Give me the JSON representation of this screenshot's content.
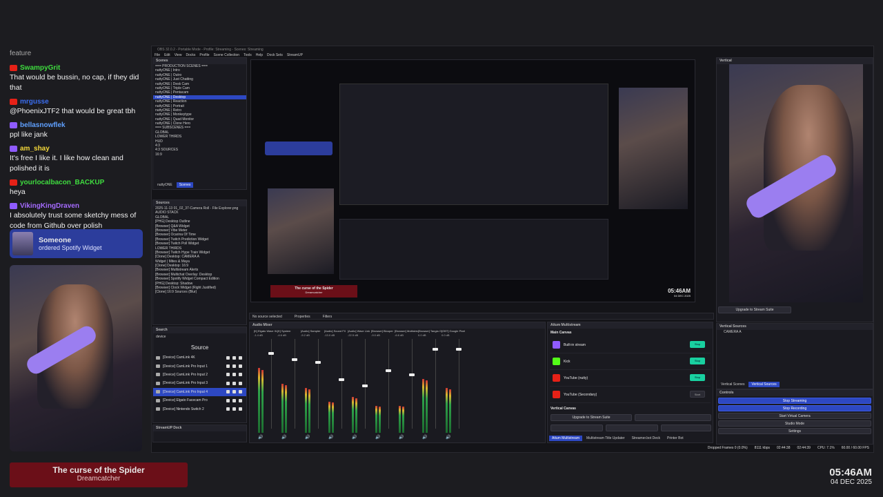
{
  "chat": {
    "header": "feature",
    "messages": [
      {
        "user": "SwampyGrit",
        "platform": "youtube",
        "color": "#3fdc3f",
        "text": "That would be bussin, no cap, if they did that"
      },
      {
        "user": "mrgusse",
        "platform": "youtube",
        "color": "#3a6df0",
        "text": "@PhoenixJTF2 that would be great tbh"
      },
      {
        "user": "bellasnowflek",
        "platform": "twitch",
        "color": "#5fa0ff",
        "text": "ppl like jank"
      },
      {
        "user": "am_shay",
        "platform": "twitch",
        "color": "#f5d93a",
        "text": "It's free I like it. I like how clean and polished it is"
      },
      {
        "user": "yourlocalbacon_BACKUP",
        "platform": "youtube",
        "color": "#3fdc3f",
        "text": "heya"
      },
      {
        "user": "VikingKingDraven",
        "platform": "twitch",
        "color": "#a56bff",
        "text": "I absolutely trust some sketchy mess of code from Github over polish"
      }
    ]
  },
  "alert": {
    "name": "Someone",
    "action": "ordered Spotify Widget"
  },
  "now_playing": {
    "title": "The curse of the Spider",
    "artist": "Dreamcatcher"
  },
  "clock": {
    "time": "05:46AM",
    "date": "04 DEC 2025"
  },
  "obs": {
    "title": "OBS 32.0.2 - Portable Mode - Profile: Streaming - Scenes: Streaming",
    "menu": [
      "File",
      "Edit",
      "View",
      "Docks",
      "Profile",
      "Scene Collection",
      "Tools",
      "Help",
      "Dock Sets",
      "StreamUP"
    ],
    "scenes_header": "Scenes",
    "scenes": [
      "=== PRODUCTION SCENES ===",
      "nuttyONE | Intro",
      "nuttyONE | Outro",
      "nuttyONE | Just Chatting",
      "nuttyONE | Desk Cam",
      "nuttyONE | Triple Cam",
      "nuttyONE | Pentacam",
      "nuttyONE | Desktop",
      "nuttyONE | Reaction",
      "nuttyONE | Portrait",
      "nuttyONE | Retro",
      "nuttyONE | Monkeytype",
      "nuttyONE | Quad Monitor",
      "nuttyONE | Clone Hero",
      "=== SUBSCENES ===",
      "GLOBAL",
      "LOWER THIRDS",
      "HUD",
      "4:3",
      "4:3 SOURCES",
      "16:9"
    ],
    "selected_scene": 7,
    "scene_tabs": [
      "nuttyONE",
      "Scenes"
    ],
    "sources_header": "Sources",
    "sources": [
      "2025-11-13 01_02_37-Camera Roll - File Explorer.png",
      "AUDIO STACK",
      "GLOBAL",
      "[PHG] Desktop Outline",
      "[Browser] Q&A Widget",
      "[Browser] Vibe Meter",
      "[Browser] Ocarina Of Time",
      "[Browser] Twitch Prediction Widget",
      "[Browser] Twitch Poll Widget",
      "LOWER THIRDS",
      "[Browser] Twitch Hype Train Widget",
      "[Clone] Desktop: CAMERA A",
      "Widget | Mites & Maya",
      "[Clone] Desktop: 16:9",
      "[Browser] Multistream Alerts",
      "[Browser] Multichat Overlay: Desktop",
      "[Browser] Spotify Widget Compact Edition",
      "[PHG] Desktop: Shadow",
      "[Browser] Clock Widget (Right Justified)",
      "[Clone] 16:9 Sources (Blur)"
    ],
    "search_header": "Search",
    "search_value": "device",
    "source_dock_title": "Source",
    "devices": [
      "[Device] CamLink 4K",
      "[Device] CamLink Pro Input 1",
      "[Device] CamLink Pro Input 2",
      "[Device] CamLink Pro Input 3",
      "[Device] CamLink Pro Input 4",
      "[Device] Elgato Facecam Pro",
      "[Device] Nintendo Switch 2"
    ],
    "selected_device": 4,
    "streamup_dock": "StreamUP Dock",
    "no_source": "No source selected",
    "properties": "Properties",
    "filters": "Filters",
    "mixer_header": "Audio Mixer",
    "mixer_channels": [
      {
        "name": "[K] Elgato Wave XLR",
        "db": "-1.4 dB",
        "level": 0.72,
        "fader": 0.85
      },
      {
        "name": "[K] System",
        "db": "-4.6 dB",
        "level": 0.55,
        "fader": 0.78
      },
      {
        "name": "[Audio] Sampler",
        "db": "-5.2 dB",
        "level": 0.5,
        "fader": 0.75
      },
      {
        "name": "[Audio] Sound FX",
        "db": "-13.0 dB",
        "level": 0.35,
        "fader": 0.55
      },
      {
        "name": "[Audio] Wave Link",
        "db": "-22.5 dB",
        "level": 0.4,
        "fader": 0.48
      },
      {
        "name": "[Browser] Blooper",
        "db": "-9.0 dB",
        "level": 0.3,
        "fader": 0.65
      },
      {
        "name": "[Browser] Multistream Al",
        "db": "-6.6 dB",
        "level": 0.3,
        "fader": 0.6
      },
      {
        "name": "[Browser] Tangia Overlay",
        "db": "0.0 dB",
        "level": 0.6,
        "fader": 0.9
      },
      {
        "name": "[OBT] Google Pixel",
        "db": "0.0 dB",
        "level": 0.5,
        "fader": 0.9
      }
    ],
    "multistream_header": "Aitum Multistream",
    "main_canvas": "Main Canvas",
    "outputs": [
      {
        "name": "Built-in stream",
        "platform": "twitch",
        "state": "on"
      },
      {
        "name": "Kick",
        "platform": "kick",
        "state": "on"
      },
      {
        "name": "YouTube (nutty)",
        "platform": "youtube",
        "state": "on"
      },
      {
        "name": "YouTube (Secondary)",
        "platform": "youtube",
        "state": "off"
      }
    ],
    "toggle_on": "Stop",
    "toggle_off": "Start",
    "vertical_canvas": "Vertical Canvas",
    "upgrade": "Upgrade to Stream Suite",
    "bottom_tabs": [
      "Aitum Multistream",
      "Multistream Title Updater",
      "Streamer.bot Deck",
      "Printer Bot"
    ],
    "vertical_header": "Vertical",
    "vertical_upgrade": "Upgrade to Stream Suite",
    "vertical_sources_header": "Vertical Sources",
    "vertical_source": "CAMERA A",
    "vertical_tabs": [
      "Vertical Scenes",
      "Vertical Sources"
    ],
    "controls_header": "Controls",
    "controls": [
      "Stop Streaming",
      "Stop Recording",
      "Start Virtual Camera",
      "Studio Mode",
      "Settings"
    ],
    "status": {
      "dropped": "Dropped Frames 0 (0.0%)",
      "bitrate": "8111 kbps",
      "stream_time": "02:44:38",
      "rec_time": "02:44:39",
      "cpu": "CPU: 7.1%",
      "fps": "60.00 / 60.00 FPS"
    },
    "preview_song_title": "The curse of the Spider",
    "preview_song_artist": "Dreamcatcher",
    "preview_clock": "05:46AM",
    "preview_date": "04 DEC 2025"
  },
  "colors": {
    "accent": "#2d48c2",
    "on": "#19d0a0",
    "twitch": "#8f5bff",
    "youtube": "#e62117",
    "kick": "#53fc18",
    "song_bg": "#6b0f18"
  }
}
